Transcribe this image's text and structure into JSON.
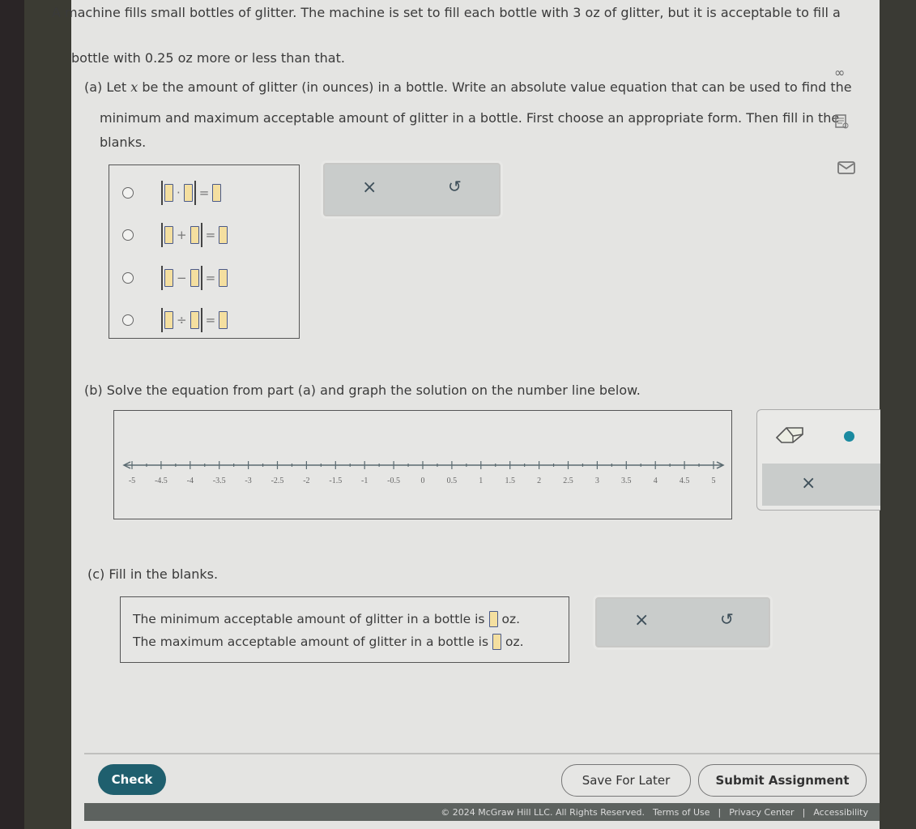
{
  "problem": {
    "line1": "A machine fills small bottles of glitter. The machine is set to fill each bottle with 3 oz of glitter, but it is acceptable to fill a",
    "line2": "bottle with 0.25 oz more or less than that."
  },
  "part_a": {
    "label": "(a)",
    "line1_pre": "Let ",
    "var": "x",
    "line1_post": " be the amount of glitter (in ounces) in a bottle. Write an absolute value equation that can be used to find the",
    "line2": "minimum and maximum acceptable amount of glitter in a bottle. First choose an appropriate form. Then fill in the",
    "line3": "blanks.",
    "choices": [
      {
        "operator": "·",
        "equals": "=",
        "selected": false
      },
      {
        "operator": "+",
        "equals": "=",
        "selected": false
      },
      {
        "operator": "−",
        "equals": "=",
        "selected": false
      },
      {
        "operator": "÷",
        "equals": "=",
        "selected": false
      }
    ],
    "tools": {
      "clear": "×",
      "undo": "↺"
    }
  },
  "part_b": {
    "text": "(b) Solve the equation from part (a) and graph the solution on the number line below.",
    "number_line": {
      "min": -5,
      "max": 5,
      "label_step": 0.5,
      "minor_step": 0.25,
      "labels": [
        "-5",
        "-4.5",
        "-4",
        "-3.5",
        "-3",
        "-2.5",
        "-2",
        "-1.5",
        "-1",
        "-0.5",
        "0",
        "0.5",
        "1",
        "1.5",
        "2",
        "2.5",
        "3",
        "3.5",
        "4",
        "4.5",
        "5"
      ]
    },
    "tools": {
      "eraser": "eraser",
      "point": "point",
      "clear": "×"
    },
    "accent_color": "#1a8aa0"
  },
  "part_c": {
    "label": "(c) Fill in the blanks.",
    "min_pre": "The minimum acceptable amount of glitter in a bottle is",
    "max_pre": "The maximum acceptable amount of glitter in a bottle is",
    "unit": "oz.",
    "min_value": "",
    "max_value": "",
    "tools": {
      "clear": "×",
      "undo": "↺"
    }
  },
  "side_icons": {
    "infinity": "∞",
    "reader": "reader",
    "mail": "mail"
  },
  "buttons": {
    "check": "Check",
    "save": "Save For Later",
    "submit": "Submit Assignment"
  },
  "footer": {
    "copyright": "© 2024 McGraw Hill LLC. All Rights Reserved.",
    "terms": "Terms of Use",
    "sep1": "|",
    "privacy": "Privacy Center",
    "sep2": "|",
    "accessibility": "Accessibility"
  },
  "colors": {
    "check_button": "#1f5f6e",
    "blank_fill": "#f4dfa0",
    "footer_bg": "#5d625f"
  }
}
